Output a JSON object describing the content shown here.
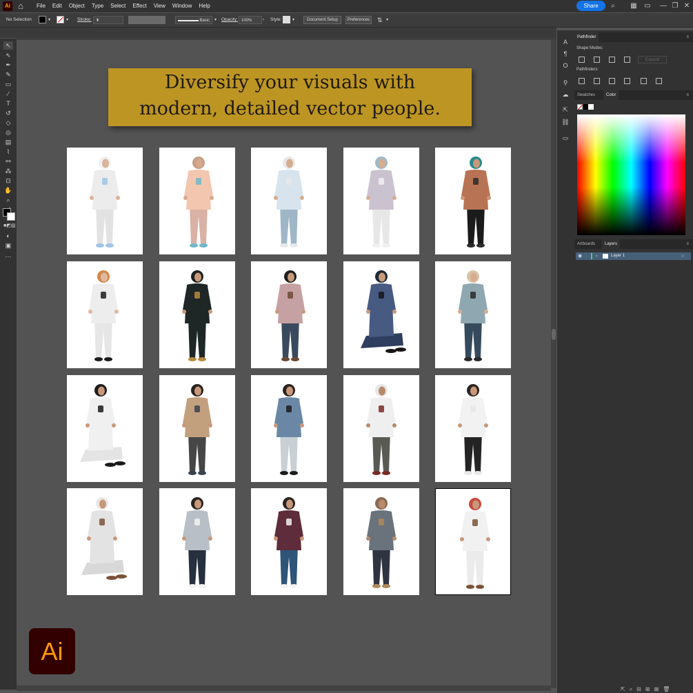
{
  "app": {
    "logo_label": "Ai",
    "menus": [
      "File",
      "Edit",
      "Object",
      "Type",
      "Select",
      "Effect",
      "View",
      "Window",
      "Help"
    ],
    "share_label": "Share",
    "window_controls": [
      "—",
      "❐",
      "✕"
    ]
  },
  "control_bar": {
    "selection_status": "No Selection",
    "stroke_label": "Stroke:",
    "brush_label": "Basic",
    "opacity_label": "Opacity:",
    "opacity_value": "100%",
    "style_label": "Style:",
    "document_setup_label": "Document Setup",
    "preferences_label": "Preferences"
  },
  "banner": {
    "line1": "Diversify your visuals with",
    "line2": "modern, detailed vector people.",
    "color": "#bd9523"
  },
  "artboards": [
    {
      "id": 1,
      "figure": "woman in white hijab holding baby",
      "colors": {
        "head": "#f1f1f1",
        "top": "#ececec",
        "bottom": "#e2e2e2",
        "accent": "#9ec4e6",
        "skin": "#d9b39a"
      }
    },
    {
      "id": 2,
      "figure": "woman in pink dress on phone",
      "colors": {
        "head": "#c69f86",
        "top": "#f3c6b0",
        "bottom": "#d9b1a5",
        "accent": "#6fb7c8",
        "skin": "#d7a98c"
      }
    },
    {
      "id": 3,
      "figure": "woman in light blue outfit with phone",
      "colors": {
        "head": "#e8e8e8",
        "top": "#d7e4ee",
        "bottom": "#9fb6c6",
        "accent": "#e8e8e8",
        "skin": "#d6ad90"
      }
    },
    {
      "id": 4,
      "figure": "woman in lilac sweater and white pants",
      "colors": {
        "head": "#9fb9c8",
        "top": "#cbc2cf",
        "bottom": "#e7e7e7",
        "accent": "#f0f0f0",
        "skin": "#d6ad90"
      }
    },
    {
      "id": 5,
      "figure": "woman in rust coat and teal scarf walking",
      "colors": {
        "head": "#2a8b8c",
        "top": "#b87354",
        "bottom": "#1b1b1b",
        "accent": "#2c2c2c",
        "skin": "#c9987a"
      }
    },
    {
      "id": 6,
      "figure": "woman in white dress and orange hat",
      "colors": {
        "head": "#d08a4c",
        "top": "#ededed",
        "bottom": "#e6e6e6",
        "accent": "#1c1c1c",
        "skin": "#e0b9a0"
      }
    },
    {
      "id": 7,
      "figure": "woman in black abaya with gold trim",
      "colors": {
        "head": "#1c2222",
        "top": "#1e2626",
        "bottom": "#1e2626",
        "accent": "#b8893f",
        "skin": "#c99a7a"
      }
    },
    {
      "id": 8,
      "figure": "woman in dusty pink coat back view",
      "colors": {
        "head": "#1e1e1e",
        "top": "#c6a1a3",
        "bottom": "#3a4a5e",
        "accent": "#6b4a34",
        "skin": "#c99a7a"
      }
    },
    {
      "id": 9,
      "figure": "woman in navy outfit sitting",
      "colors": {
        "head": "#1f2838",
        "top": "#475a82",
        "bottom": "#2e3e5e",
        "accent": "#151515",
        "skin": "#c99a7a"
      }
    },
    {
      "id": 10,
      "figure": "woman in floral hijab reading",
      "colors": {
        "head": "#d9c3a6",
        "top": "#8fa7b0",
        "bottom": "#354a5c",
        "accent": "#2a2a2a",
        "skin": "#d6ad90"
      }
    },
    {
      "id": 11,
      "figure": "bearded man in white praying",
      "colors": {
        "head": "#1c1c1c",
        "top": "#f0f0f0",
        "bottom": "#e4e4e4",
        "accent": "#1a1a1a",
        "skin": "#c9987a"
      }
    },
    {
      "id": 12,
      "figure": "man in tan jacket and grey pants",
      "colors": {
        "head": "#2a2420",
        "top": "#c2a07e",
        "bottom": "#464646",
        "accent": "#3a4350",
        "skin": "#c9987a"
      }
    },
    {
      "id": 13,
      "figure": "man in blue striped sweater",
      "colors": {
        "head": "#2a2420",
        "top": "#6a88a6",
        "bottom": "#c8d0d6",
        "accent": "#1b1b1b",
        "skin": "#c9987a"
      }
    },
    {
      "id": 14,
      "figure": "elderly man in white scarf",
      "colors": {
        "head": "#e6e6e6",
        "top": "#efefef",
        "bottom": "#5a5a54",
        "accent": "#7a2a22",
        "skin": "#b98a6a"
      }
    },
    {
      "id": 15,
      "figure": "man in white sweater with coffee",
      "colors": {
        "head": "#2a2420",
        "top": "#f2f2f2",
        "bottom": "#242424",
        "accent": "#e8e8e8",
        "skin": "#c9987a"
      }
    },
    {
      "id": 16,
      "figure": "man in white thobe sitting",
      "colors": {
        "head": "#e8e8e8",
        "top": "#e3e3e3",
        "bottom": "#d8d8d8",
        "accent": "#7a5238",
        "skin": "#c9987a"
      }
    },
    {
      "id": 17,
      "figure": "man in grey jacket and navy pants",
      "colors": {
        "head": "#2a2420",
        "top": "#b8bfc6",
        "bottom": "#26303e",
        "accent": "#f2f2f2",
        "skin": "#c9987a"
      }
    },
    {
      "id": 18,
      "figure": "man in burgundy jacket and jeans",
      "colors": {
        "head": "#2a2420",
        "top": "#5e2c3a",
        "bottom": "#2e5478",
        "accent": "#f2f2f2",
        "skin": "#c9987a"
      }
    },
    {
      "id": 19,
      "figure": "elderly man with cane back view",
      "colors": {
        "head": "#8a6a54",
        "top": "#6a737c",
        "bottom": "#2e3440",
        "accent": "#b08a5a",
        "skin": "#b98a6a"
      }
    },
    {
      "id": 20,
      "figure": "man in white thobe and red keffiyeh walking",
      "colors": {
        "head": "#c84a3e",
        "top": "#f1f1f1",
        "bottom": "#ebebeb",
        "accent": "#7a5238",
        "skin": "#c9987a"
      }
    }
  ],
  "panels": {
    "pathfinder": {
      "tab": "Pathfinder",
      "shape_modes_label": "Shape Modes:",
      "pathfinders_label": "Pathfinders:",
      "expand_label": "Expand"
    },
    "color": {
      "tabs": [
        "Swatches",
        "Color"
      ]
    },
    "layers": {
      "tabs": [
        "Artboards",
        "Layers"
      ],
      "layer_name": "Layer 1",
      "layer_color": "#46607a"
    }
  },
  "brand_badge": {
    "label": "Ai",
    "background": "#330000",
    "foreground": "#ff9a00"
  }
}
